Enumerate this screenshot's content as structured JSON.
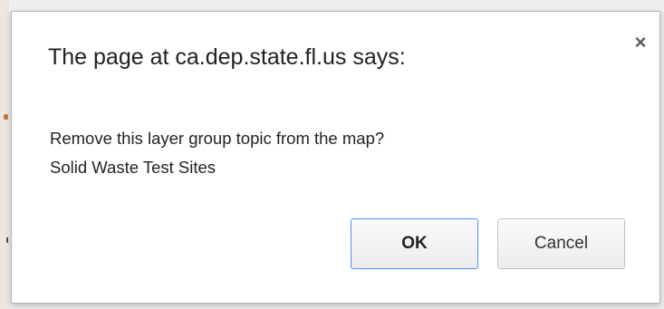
{
  "dialog": {
    "title": "The page at ca.dep.state.fl.us says:",
    "close_icon": "close-icon",
    "close_glyph": "×",
    "message_line_1": "Remove this layer group topic from the map?",
    "message_line_2": "Solid Waste Test Sites",
    "ok_label": "OK",
    "cancel_label": "Cancel",
    "accent_color": "#4d90fe"
  }
}
